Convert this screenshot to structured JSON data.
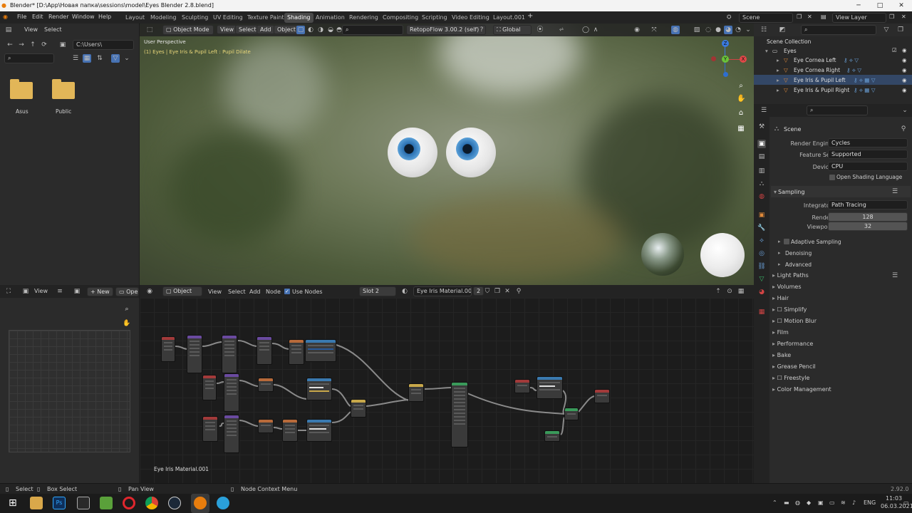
{
  "window": {
    "title": "Blender* [D:\\App\\Новая папка\\sessions\\model\\Eyes Blender 2.8.blend]"
  },
  "menu": {
    "items": [
      "File",
      "Edit",
      "Render",
      "Window",
      "Help"
    ]
  },
  "workspace_tabs": [
    "Layout",
    "Modeling",
    "Sculpting",
    "UV Editing",
    "Texture Paint",
    "Shading",
    "Animation",
    "Rendering",
    "Compositing",
    "Scripting",
    "Video Editing",
    "Layout.001"
  ],
  "active_tab": "Shading",
  "scene_field": "Scene",
  "view_layer_field": "View Layer",
  "file_browser": {
    "header": {
      "view": "View",
      "select": "Select"
    },
    "path": "C:\\Users\\",
    "folders": [
      "Asus",
      "Public"
    ]
  },
  "image_editor": {
    "view": "View",
    "new": "New",
    "open": "Open"
  },
  "viewport": {
    "header": {
      "mode": "Object Mode",
      "view": "View",
      "select": "Select",
      "add": "Add",
      "object": "Object",
      "addon": "RetopoFlow 3.00.2 (self)",
      "transform": "Global"
    },
    "perspective_label": "User Perspective",
    "object_label": "(1) Eyes | Eye Iris & Pupil Left : Pupil Dilate",
    "gizmo": {
      "x": "X",
      "y": "Y",
      "z": "Z"
    }
  },
  "node_editor": {
    "header": {
      "object": "Object",
      "view": "View",
      "select": "Select",
      "add": "Add",
      "node": "Node",
      "use_nodes": "Use Nodes",
      "slot": "Slot 2",
      "material": "Eye Iris Material.001",
      "users": "2"
    },
    "material_label": "Eye Iris Material.001"
  },
  "outliner": {
    "title": "Scene Collection",
    "collection": "Eyes",
    "items": [
      "Eye Cornea Left",
      "Eye Cornea Right",
      "Eye Iris & Pupil Left",
      "Eye Iris & Pupil Right"
    ]
  },
  "properties": {
    "scene_title": "Scene",
    "render_engine": {
      "label": "Render Engine",
      "value": "Cycles"
    },
    "feature_set": {
      "label": "Feature Set",
      "value": "Supported"
    },
    "device": {
      "label": "Device",
      "value": "CPU"
    },
    "osl": "Open Shading Language",
    "sampling": {
      "title": "Sampling",
      "integrator_label": "Integrator",
      "integrator": "Path Tracing",
      "render_label": "Render",
      "render": "128",
      "viewport_label": "Viewport",
      "viewport": "32"
    },
    "sub_sections": [
      "Adaptive Sampling",
      "Denoising",
      "Advanced"
    ],
    "sections": [
      "Light Paths",
      "Volumes",
      "Hair",
      "Simplify",
      "Motion Blur",
      "Film",
      "Performance",
      "Bake",
      "Grease Pencil",
      "Freestyle",
      "Color Management"
    ]
  },
  "statusbar": {
    "select": "Select",
    "box_select": "Box Select",
    "pan_view": "Pan View",
    "context_menu": "Node Context Menu",
    "version": "2.92.0"
  },
  "taskbar": {
    "lang": "ENG",
    "time": "11:03",
    "date": "06.03.2021"
  },
  "colors": {
    "accent": "#4772b3",
    "orange": "#e08a3a",
    "header": "#2b2b2b"
  }
}
